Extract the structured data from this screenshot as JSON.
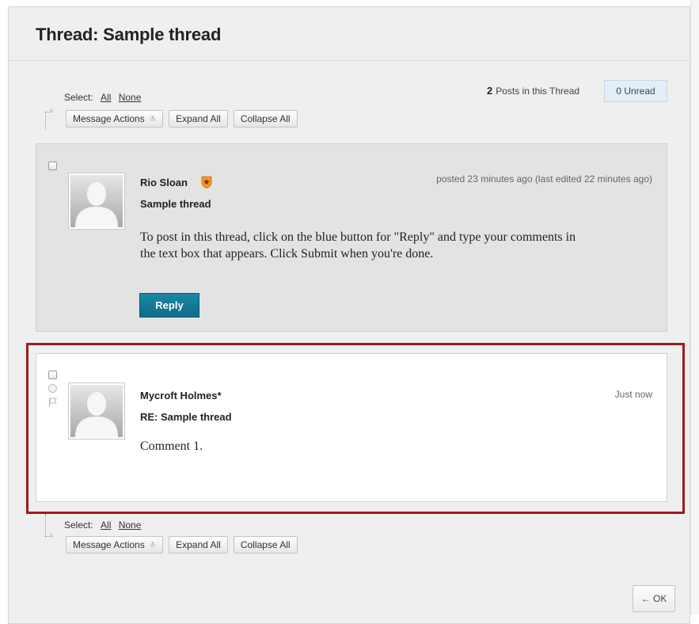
{
  "page": {
    "title": "Thread: Sample thread"
  },
  "toolbar_top": {
    "select_label": "Select:",
    "select_all": "All",
    "select_none": "None",
    "message_actions": "Message Actions",
    "expand_all": "Expand All",
    "collapse_all": "Collapse All"
  },
  "toolbar_bottom": {
    "select_label": "Select:",
    "select_all": "All",
    "select_none": "None",
    "message_actions": "Message Actions",
    "expand_all": "Expand All",
    "collapse_all": "Collapse All"
  },
  "thread_stats": {
    "post_count": "2",
    "posts_label": "Posts in this Thread",
    "unread": "0 Unread"
  },
  "posts": [
    {
      "author": "Rio Sloan",
      "author_badge_icon": "star-badge-icon",
      "posted": "posted 23 minutes ago (last edited 22 minutes ago)",
      "subject": "Sample thread",
      "body_line1": "To post in this thread, click on the blue button for \"Reply\" and type your comments in",
      "body_line2": "the text box that appears. Click Submit when you're done.",
      "reply_label": "Reply"
    },
    {
      "author": "Mycroft Holmes*",
      "posted": "Just now",
      "subject": "RE: Sample thread",
      "body_line1": "Comment 1."
    }
  ],
  "footer": {
    "ok_label": "← OK"
  },
  "colors": {
    "highlight_border": "#9e1b1f",
    "reply_button": "#127a97",
    "unread_bg": "#e4eef6"
  }
}
